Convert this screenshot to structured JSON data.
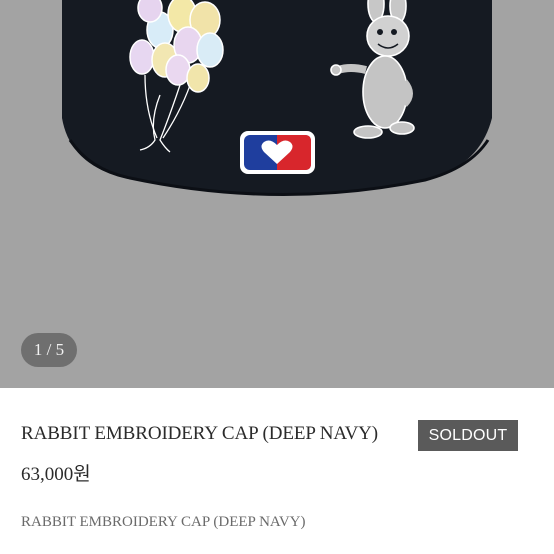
{
  "gallery": {
    "counter": "1 / 5",
    "image_alt": "cap rear embroidery: balloons, rabbit and heart logo patch"
  },
  "product": {
    "name": "RABBIT EMBROIDERY CAP (DEEP NAVY)",
    "status_badge": "SOLDOUT",
    "price": "63,000원",
    "description": "RABBIT EMBROIDERY CAP (DEEP NAVY)"
  },
  "colors": {
    "gallery_background": "#a3a3a3",
    "cap": "#151a22",
    "badge": "#5a5a5a"
  }
}
